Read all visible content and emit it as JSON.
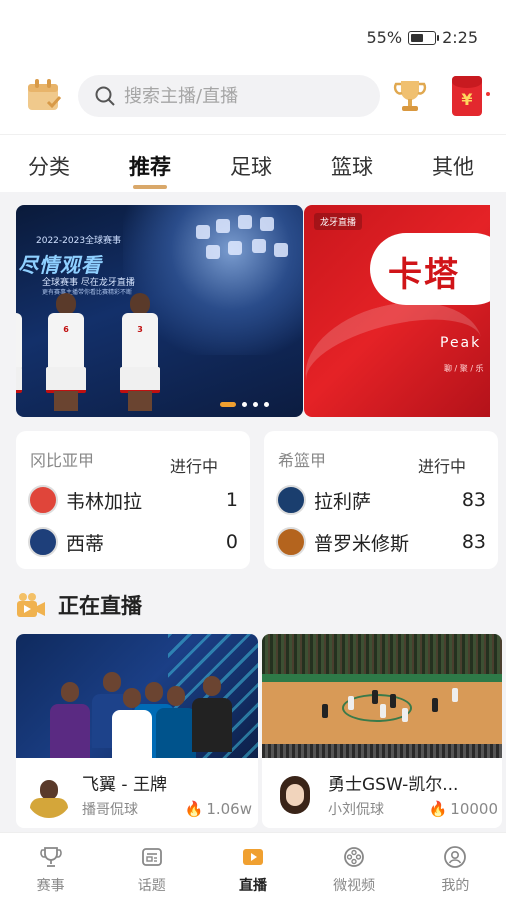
{
  "status_bar": {
    "battery": "55%",
    "battery_level": 0.55,
    "time": "2:25"
  },
  "header": {
    "calendar_icon": "calendar-check-icon",
    "search_placeholder": "搜索主播/直播",
    "trophy_icon": "trophy-icon",
    "redpacket_icon": "red-packet-icon",
    "redpacket_symbol": "¥"
  },
  "tabs": [
    {
      "label": "分类",
      "active": false
    },
    {
      "label": "推荐",
      "active": true
    },
    {
      "label": "足球",
      "active": false
    },
    {
      "label": "篮球",
      "active": false
    },
    {
      "label": "其他",
      "active": false
    }
  ],
  "banners": {
    "main": {
      "small_caption": "2022-2023全球赛事",
      "big_caption": "尽情观看",
      "line1": "全球赛事  尽在龙牙直播",
      "line2": "更有赛事主播带你看比赛精彩不断",
      "players": [
        "6",
        "3"
      ]
    },
    "next": {
      "brand": "龙牙直播",
      "headline": "卡塔",
      "sub": "Peak",
      "sub2": "聊 / 聚 / 乐"
    },
    "active_index": 0,
    "count": 4
  },
  "matches": [
    {
      "league": "冈比亚甲",
      "status": "进行中",
      "teams": [
        {
          "name": "韦林加拉",
          "score": "1",
          "logo_color": "#e0453a"
        },
        {
          "name": "西蒂",
          "score": "0",
          "logo_color": "#1e3f7a"
        }
      ]
    },
    {
      "league": "希篮甲",
      "status": "进行中",
      "teams": [
        {
          "name": "拉利萨",
          "score": "83",
          "logo_color": "#1a3e6e"
        },
        {
          "name": "普罗米修斯",
          "score": "83",
          "logo_color": "#b4641e"
        }
      ]
    }
  ],
  "live_section": {
    "title": "正在直播",
    "icon": "video-camera-icon"
  },
  "live_rooms": [
    {
      "title": "飞翼 - 王牌",
      "anchor": "播哥侃球",
      "heat": "1.06w",
      "avatar_color": "#8a1a1a"
    },
    {
      "title": "勇士GSW-凯尔...",
      "anchor": "小刘侃球",
      "heat": "10000",
      "avatar_color": "#caa37a"
    }
  ],
  "bottom_nav": [
    {
      "label": "赛事",
      "icon": "trophy-icon",
      "active": false
    },
    {
      "label": "话题",
      "icon": "topic-card-icon",
      "active": false
    },
    {
      "label": "直播",
      "icon": "play-tv-icon",
      "active": true
    },
    {
      "label": "微视频",
      "icon": "film-reel-icon",
      "active": false
    },
    {
      "label": "我的",
      "icon": "user-icon",
      "active": false
    }
  ],
  "colors": {
    "accent": "#d9a86a",
    "flame": "#f05a1a",
    "nav_active": "#f0a030"
  }
}
